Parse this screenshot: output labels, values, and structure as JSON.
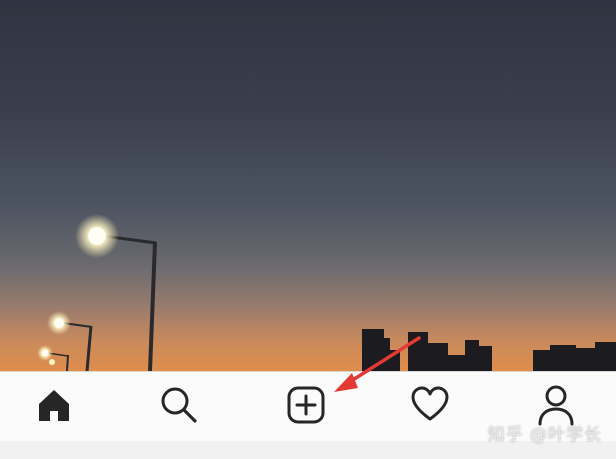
{
  "tab_bar": {
    "tabs": [
      {
        "id": "home",
        "icon": "home-icon"
      },
      {
        "id": "search",
        "icon": "search-icon"
      },
      {
        "id": "new-post",
        "icon": "add-post-icon"
      },
      {
        "id": "activity",
        "icon": "heart-icon"
      },
      {
        "id": "profile",
        "icon": "profile-icon"
      }
    ]
  },
  "watermark": {
    "text": "知乎 @叶学长"
  },
  "annotation": {
    "arrow_color": "#e53935"
  }
}
